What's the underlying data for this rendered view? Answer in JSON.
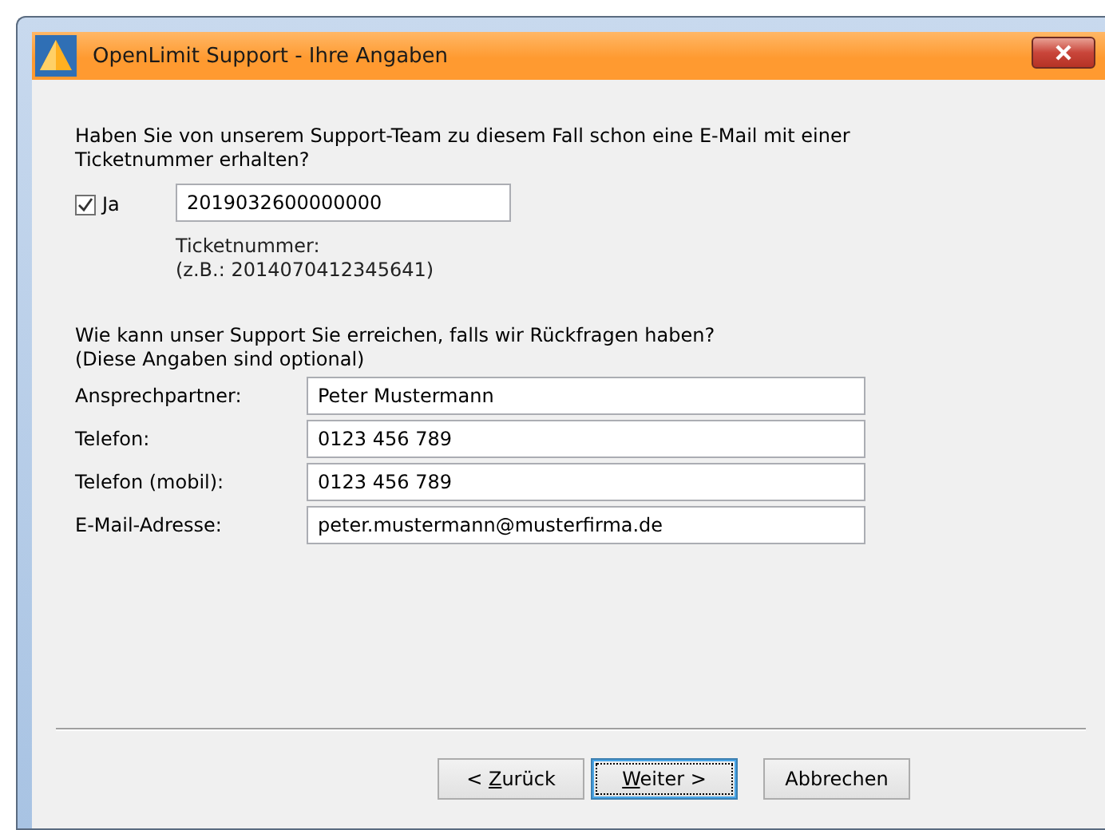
{
  "window": {
    "title": "OpenLimit Support - Ihre Angaben"
  },
  "ticket": {
    "question": "Haben Sie von unserem Support-Team zu diesem Fall schon eine E-Mail mit einer Ticketnummer erhalten?",
    "checkbox": {
      "label": "Ja",
      "checked": true
    },
    "value": "2019032600000000",
    "hint_lines": [
      "Ticketnummer:",
      "(z.B.: 2014070412345641)"
    ]
  },
  "contact": {
    "intro_lines": [
      "Wie kann unser Support Sie erreichen, falls wir Rückfragen haben?",
      "(Diese Angaben sind optional)"
    ],
    "fields": [
      {
        "label": "Ansprechpartner:",
        "value": "Peter Mustermann"
      },
      {
        "label": "Telefon:",
        "value": "0123 456 789"
      },
      {
        "label": "Telefon (mobil):",
        "value": "0123 456 789"
      },
      {
        "label": "E-Mail-Adresse:",
        "value": "peter.mustermann@musterfirma.de"
      }
    ]
  },
  "buttons": [
    {
      "label_before": "< ",
      "access_key": "Z",
      "label_after": "urück",
      "default": false
    },
    {
      "access_key": "W",
      "label_after": "eiter >",
      "default": true
    },
    {
      "label_before": "Abbrechen",
      "default": false
    }
  ]
}
